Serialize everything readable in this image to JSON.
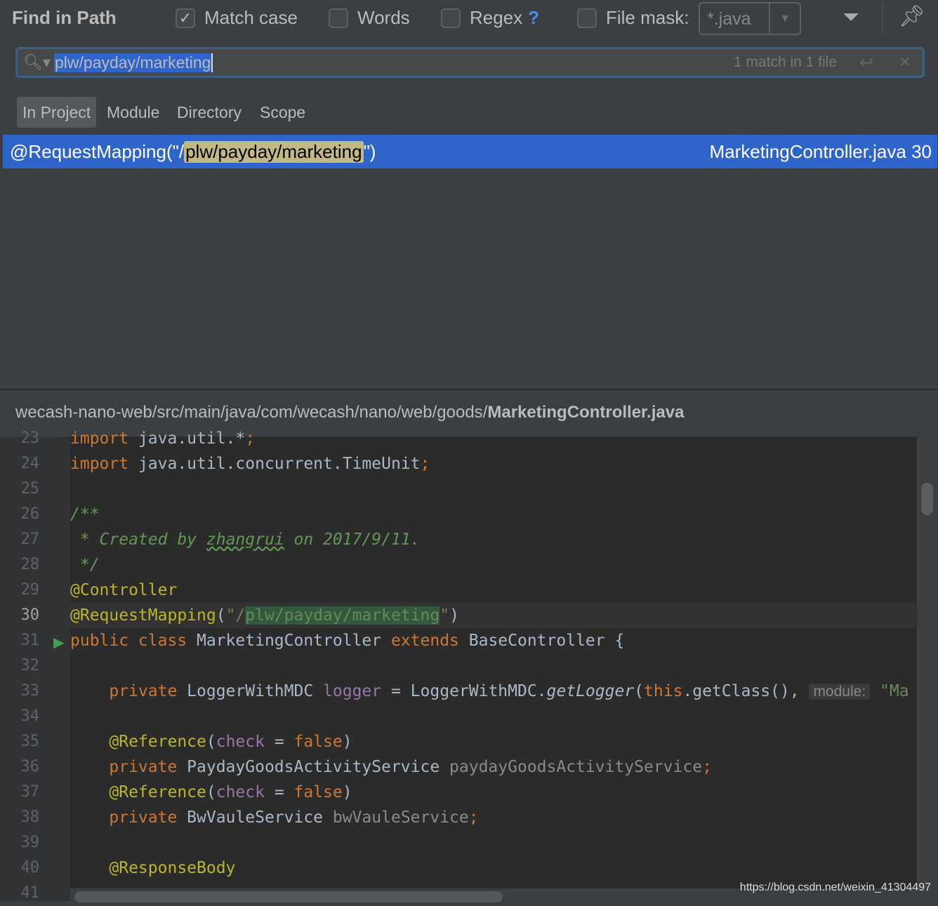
{
  "header": {
    "title": "Find in Path",
    "options": [
      {
        "label": "Match case",
        "checked": true
      },
      {
        "label": "Words",
        "checked": false
      },
      {
        "label": "Regex",
        "checked": false,
        "help": "?"
      },
      {
        "label": "File mask:",
        "checked": false
      }
    ],
    "file_mask": "*.java",
    "icons": [
      "filter-icon",
      "pin-icon"
    ]
  },
  "search": {
    "query": "plw/payday/marketing",
    "count": "1 match in 1 file"
  },
  "scopes": [
    {
      "label": "In Project",
      "active": true
    },
    {
      "label": "Module"
    },
    {
      "label": "Directory"
    },
    {
      "label": "Scope"
    }
  ],
  "result": {
    "prefix": "@RequestMapping(\"/",
    "match": "plw/payday/marketing",
    "suffix": "\")",
    "file": "MarketingController.java 30"
  },
  "path": {
    "dir": "wecash-nano-web/src/main/java/com/wecash/nano/web/goods/",
    "file": "MarketingController.java"
  },
  "editor": {
    "current_line": 30,
    "lines": [
      {
        "n": "23",
        "t": [
          [
            "import ",
            "kw"
          ],
          [
            "java.util.*",
            "plain"
          ],
          [
            ";",
            "kw"
          ]
        ]
      },
      {
        "n": "24",
        "t": [
          [
            "import ",
            "kw"
          ],
          [
            "java.util.concurrent.TimeUnit",
            "plain"
          ],
          [
            ";",
            "kw"
          ]
        ]
      },
      {
        "n": "25",
        "t": []
      },
      {
        "n": "26",
        "t": [
          [
            "/**",
            "cm"
          ]
        ]
      },
      {
        "n": "27",
        "t": [
          [
            " * Created by ",
            "cm"
          ],
          [
            "zhangrui",
            "cmu"
          ],
          [
            " on 2017/9/11.",
            "cm"
          ]
        ]
      },
      {
        "n": "28",
        "t": [
          [
            " */",
            "cm"
          ]
        ]
      },
      {
        "n": "29",
        "t": [
          [
            "@Controller",
            "an"
          ]
        ]
      },
      {
        "n": "30",
        "t": [
          [
            "@RequestMapping",
            "an"
          ],
          [
            "(",
            "plain"
          ],
          [
            "\"/",
            "st"
          ],
          [
            "plw/payday/marketing",
            "sm"
          ],
          [
            "\"",
            "st"
          ],
          [
            ")",
            "plain"
          ]
        ]
      },
      {
        "n": "31",
        "t": [
          [
            "public class ",
            "kw"
          ],
          [
            "MarketingController ",
            "plain"
          ],
          [
            "extends ",
            "kw"
          ],
          [
            "BaseController {",
            "plain"
          ]
        ]
      },
      {
        "n": "32",
        "t": []
      },
      {
        "n": "33",
        "t": [
          [
            "    private ",
            "kw"
          ],
          [
            "LoggerWithMDC ",
            "plain"
          ],
          [
            "logger",
            "fd"
          ],
          [
            " = LoggerWithMDC.",
            "plain"
          ],
          [
            "getLogger",
            "it"
          ],
          [
            "(",
            "plain"
          ],
          [
            "this",
            "kw"
          ],
          [
            ".getClass(), ",
            "plain"
          ],
          [
            "module:",
            "hint"
          ],
          [
            " \"Ma",
            "st"
          ]
        ]
      },
      {
        "n": "34",
        "t": []
      },
      {
        "n": "35",
        "t": [
          [
            "    @Reference",
            "an"
          ],
          [
            "(",
            "plain"
          ],
          [
            "check",
            "fd"
          ],
          [
            " = ",
            "plain"
          ],
          [
            "false",
            "kw"
          ],
          [
            ")",
            "plain"
          ]
        ]
      },
      {
        "n": "36",
        "t": [
          [
            "    private ",
            "kw"
          ],
          [
            "PaydayGoodsActivityService ",
            "plain"
          ],
          [
            "paydayGoodsActivityService",
            "grey"
          ],
          [
            ";",
            "kw"
          ]
        ]
      },
      {
        "n": "37",
        "t": [
          [
            "    @Reference",
            "an"
          ],
          [
            "(",
            "plain"
          ],
          [
            "check",
            "fd"
          ],
          [
            " = ",
            "plain"
          ],
          [
            "false",
            "kw"
          ],
          [
            ")",
            "plain"
          ]
        ]
      },
      {
        "n": "38",
        "t": [
          [
            "    private ",
            "kw"
          ],
          [
            "BwVauleService ",
            "plain"
          ],
          [
            "bwVauleService",
            "grey"
          ],
          [
            ";",
            "kw"
          ]
        ]
      },
      {
        "n": "39",
        "t": []
      },
      {
        "n": "40",
        "t": [
          [
            "    @ResponseBody",
            "an"
          ]
        ]
      },
      {
        "n": "41",
        "t": []
      }
    ]
  },
  "watermark": "https://blog.csdn.net/weixin_41304497"
}
